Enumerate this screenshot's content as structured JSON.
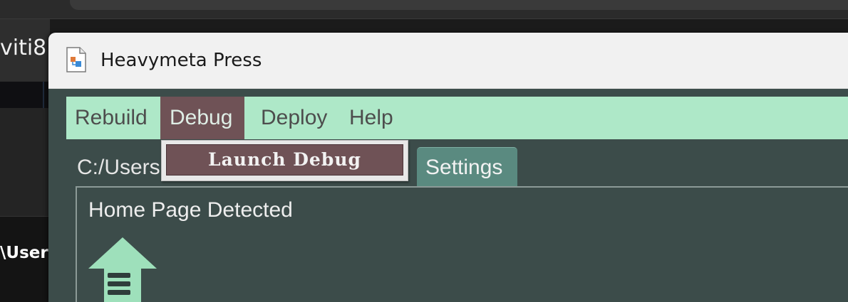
{
  "background_app": {
    "left_text": "viti8",
    "bottom_text": "\\Users"
  },
  "window": {
    "title": "Heavymeta Press",
    "icon": "document-app-icon"
  },
  "menubar": {
    "items": [
      {
        "label": "Rebuild"
      },
      {
        "label": "Debug"
      },
      {
        "label": "Deploy"
      },
      {
        "label": "Help"
      }
    ],
    "active_item": "Debug",
    "background_color": "#aee8c8",
    "active_color": "#6f5256"
  },
  "dropdown": {
    "items": [
      {
        "label": "Launch Debug"
      }
    ]
  },
  "tabs": {
    "path_tab": "C:/Users",
    "settings_tab": "Settings"
  },
  "panel": {
    "status": "Home Page Detected",
    "icon": "home-page-arrow-icon",
    "icon_color": "#9ee0bb"
  }
}
